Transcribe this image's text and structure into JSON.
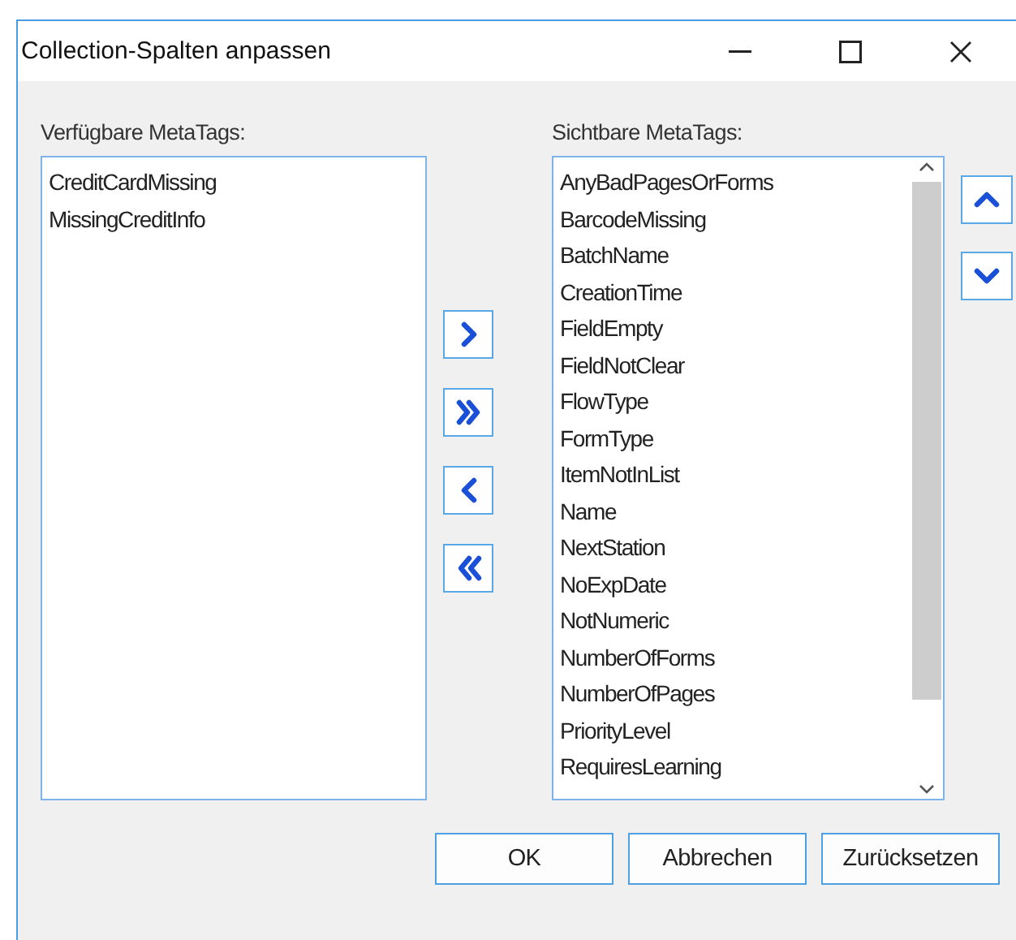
{
  "window": {
    "title": "Collection-Spalten anpassen"
  },
  "available": {
    "label": "Verfügbare MetaTags:",
    "items": [
      "CreditCardMissing",
      "MissingCreditInfo"
    ]
  },
  "visible": {
    "label": "Sichtbare MetaTags:",
    "items": [
      "AnyBadPagesOrForms",
      "BarcodeMissing",
      "BatchName",
      "CreationTime",
      "FieldEmpty",
      "FieldNotClear",
      "FlowType",
      "FormType",
      "ItemNotInList",
      "Name",
      "NextStation",
      "NoExpDate",
      "NotNumeric",
      "NumberOfForms",
      "NumberOfPages",
      "PriorityLevel",
      "RequiresLearning"
    ]
  },
  "buttons": [
    "OK",
    "Abbrechen",
    "Zurücksetzen"
  ]
}
